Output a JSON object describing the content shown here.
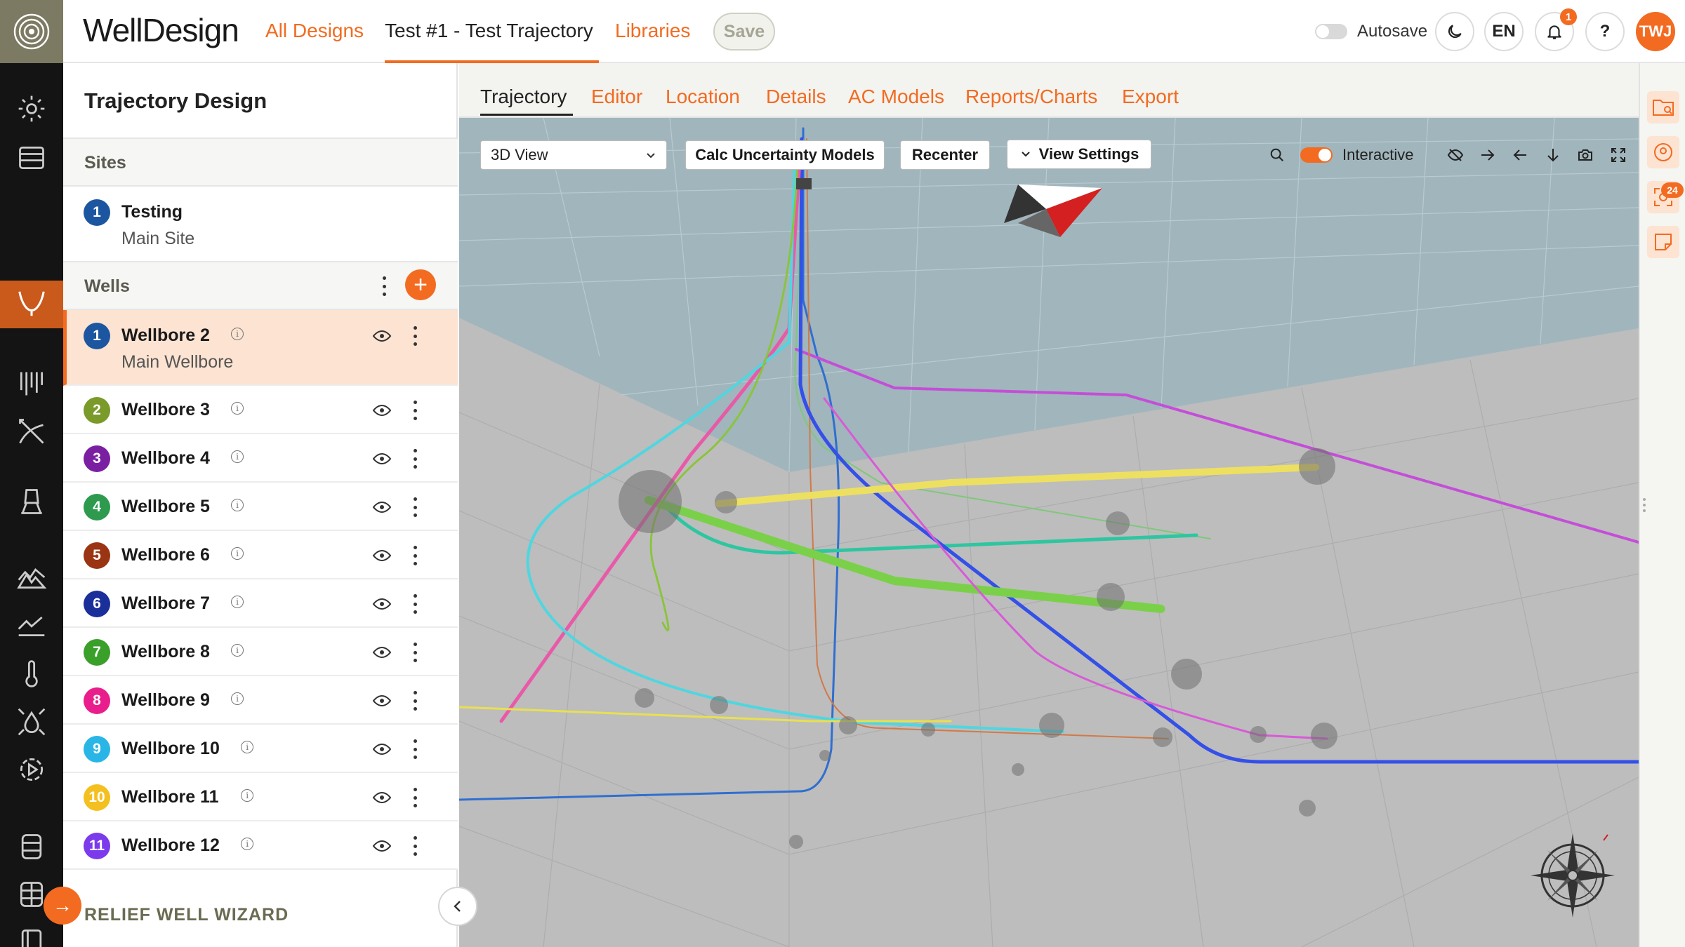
{
  "header": {
    "brand": "WellDesign",
    "nav": {
      "all_designs": "All Designs",
      "current": "Test #1 - Test Trajectory",
      "libraries": "Libraries"
    },
    "save_label": "Save",
    "autosave_label": "Autosave",
    "language": "EN",
    "notification_count": "1",
    "help": "?",
    "user_initials": "TWJ",
    "accent_color": "#f26b21"
  },
  "rail_icons": [
    "settings-icon",
    "layers-icon",
    "trajectory-icon",
    "seismic-icon",
    "path-icon",
    "rig-icon",
    "terrain-icon",
    "chart-icon",
    "thermometer-icon",
    "drops-icon",
    "gear-play-icon",
    "stack-icon",
    "grid-stack-icon",
    "book-icon"
  ],
  "panel": {
    "title": "Trajectory Design",
    "sites_label": "Sites",
    "site": {
      "number": "1",
      "name": "Testing",
      "sub": "Main Site"
    },
    "wells_label": "Wells",
    "wells": [
      {
        "number": "1",
        "name": "Wellbore 2",
        "sub": "Main Wellbore",
        "color": "#1c56a0"
      },
      {
        "number": "2",
        "name": "Wellbore 3",
        "color": "#7a9a2a"
      },
      {
        "number": "3",
        "name": "Wellbore 4",
        "color": "#7b1fa2"
      },
      {
        "number": "4",
        "name": "Wellbore 5",
        "color": "#2e9a4e"
      },
      {
        "number": "5",
        "name": "Wellbore 6",
        "color": "#9a3412"
      },
      {
        "number": "6",
        "name": "Wellbore 7",
        "color": "#1a2f9a"
      },
      {
        "number": "7",
        "name": "Wellbore 8",
        "color": "#3aa02a"
      },
      {
        "number": "8",
        "name": "Wellbore 9",
        "color": "#e91e8c"
      },
      {
        "number": "9",
        "name": "Wellbore 10",
        "color": "#29b6e6"
      },
      {
        "number": "10",
        "name": "Wellbore 11",
        "color": "#f4c020"
      },
      {
        "number": "11",
        "name": "Wellbore 12",
        "color": "#7c3aed"
      }
    ],
    "relief_wizard": "RELIEF WELL WIZARD"
  },
  "tabs": [
    "Trajectory",
    "Editor",
    "Location",
    "Details",
    "AC Models",
    "Reports/Charts",
    "Export"
  ],
  "viewport": {
    "view_select": "3D View",
    "calc_button": "Calc Uncertainty Models",
    "recenter_button": "Recenter",
    "view_settings_button": "View Settings",
    "interactive_label": "Interactive"
  },
  "right_rail": {
    "badge": "24"
  }
}
